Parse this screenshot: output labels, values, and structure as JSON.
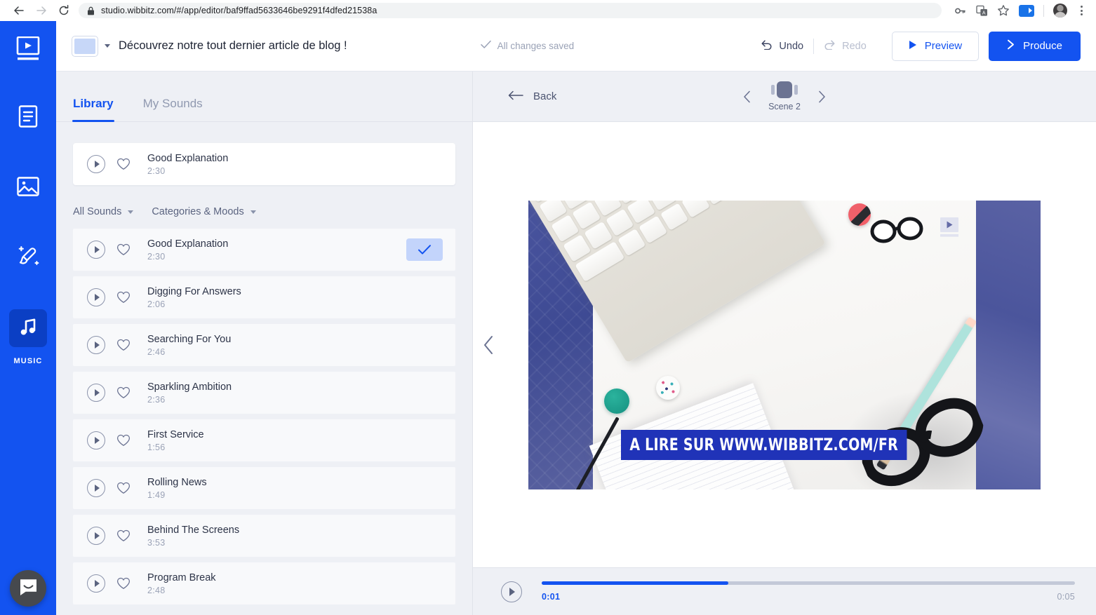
{
  "browser": {
    "url": "studio.wibbitz.com/#/app/editor/baf9ffad5633646be9291f4dfed21538a",
    "back_icon": "back-arrow-icon",
    "forward_icon": "forward-arrow-icon",
    "reload_icon": "reload-icon",
    "lock_icon": "lock-icon",
    "right_icons": [
      "key-icon",
      "translate-icon",
      "bookmark-star-icon",
      "video-camera-icon",
      "profile-avatar",
      "kebab-menu-icon"
    ]
  },
  "rail": {
    "logo_icon": "wibbitz-play-logo-icon",
    "items": [
      {
        "icon": "text-document-icon",
        "label": "",
        "active": false
      },
      {
        "icon": "image-media-icon",
        "label": "",
        "active": false
      },
      {
        "icon": "magic-brush-icon",
        "label": "",
        "active": false
      },
      {
        "icon": "music-note-icon",
        "label": "MUSIC",
        "active": true
      }
    ]
  },
  "topbar": {
    "thumbnail_name": "project-thumbnail",
    "caret_icon": "chevron-down-icon",
    "project_title": "Découvrez notre tout dernier article de blog !",
    "saved_icon": "check-icon",
    "saved_text": "All changes saved",
    "undo_label": "Undo",
    "undo_icon": "undo-arrow-icon",
    "redo_label": "Redo",
    "redo_icon": "redo-arrow-icon",
    "preview_label": "Preview",
    "preview_icon": "play-triangle-icon",
    "produce_label": "Produce",
    "produce_icon": "chevron-right-icon"
  },
  "panel": {
    "tabs": [
      {
        "label": "Library",
        "active": true
      },
      {
        "label": "My Sounds",
        "active": false
      }
    ],
    "selected_track": {
      "name": "Good Explanation",
      "duration": "2:30",
      "play_icon": "play-circle-icon",
      "favorite_icon": "heart-outline-icon"
    },
    "filters": [
      {
        "label": "All Sounds",
        "caret": "chevron-down-icon"
      },
      {
        "label": "Categories & Moods",
        "caret": "chevron-down-icon"
      }
    ],
    "tracks": [
      {
        "name": "Good Explanation",
        "duration": "2:30",
        "selected": true
      },
      {
        "name": "Digging For Answers",
        "duration": "2:06",
        "selected": false
      },
      {
        "name": "Searching For You",
        "duration": "2:46",
        "selected": false
      },
      {
        "name": "Sparkling Ambition",
        "duration": "2:36",
        "selected": false
      },
      {
        "name": "First Service",
        "duration": "1:56",
        "selected": false
      },
      {
        "name": "Rolling News",
        "duration": "1:49",
        "selected": false
      },
      {
        "name": "Behind The Screens",
        "duration": "3:53",
        "selected": false
      },
      {
        "name": "Program Break",
        "duration": "2:48",
        "selected": false
      }
    ]
  },
  "preview": {
    "back_label": "Back",
    "back_icon": "arrow-left-icon",
    "prev_scene_icon": "chevron-left-icon",
    "next_scene_icon": "chevron-right-icon",
    "scene_label": "Scene 2",
    "stage_prev_icon": "chevron-left-icon",
    "video_caption": "A LIRE SUR WWW.WIBBITZ.COM/FR",
    "watermark_icon": "wibbitz-play-watermark-icon"
  },
  "player": {
    "play_icon": "play-circle-icon",
    "current_time": "0:01",
    "total_time": "0:05",
    "progress_percent": 35
  },
  "intercom": {
    "icon": "intercom-chat-bubble-icon"
  },
  "colors": {
    "brand_blue": "#1353f0",
    "rail_active": "#0b3fc4",
    "panel_bg": "#eef0f5",
    "check_chip": "#c3d4fb",
    "caption_blue": "#2033b8"
  }
}
